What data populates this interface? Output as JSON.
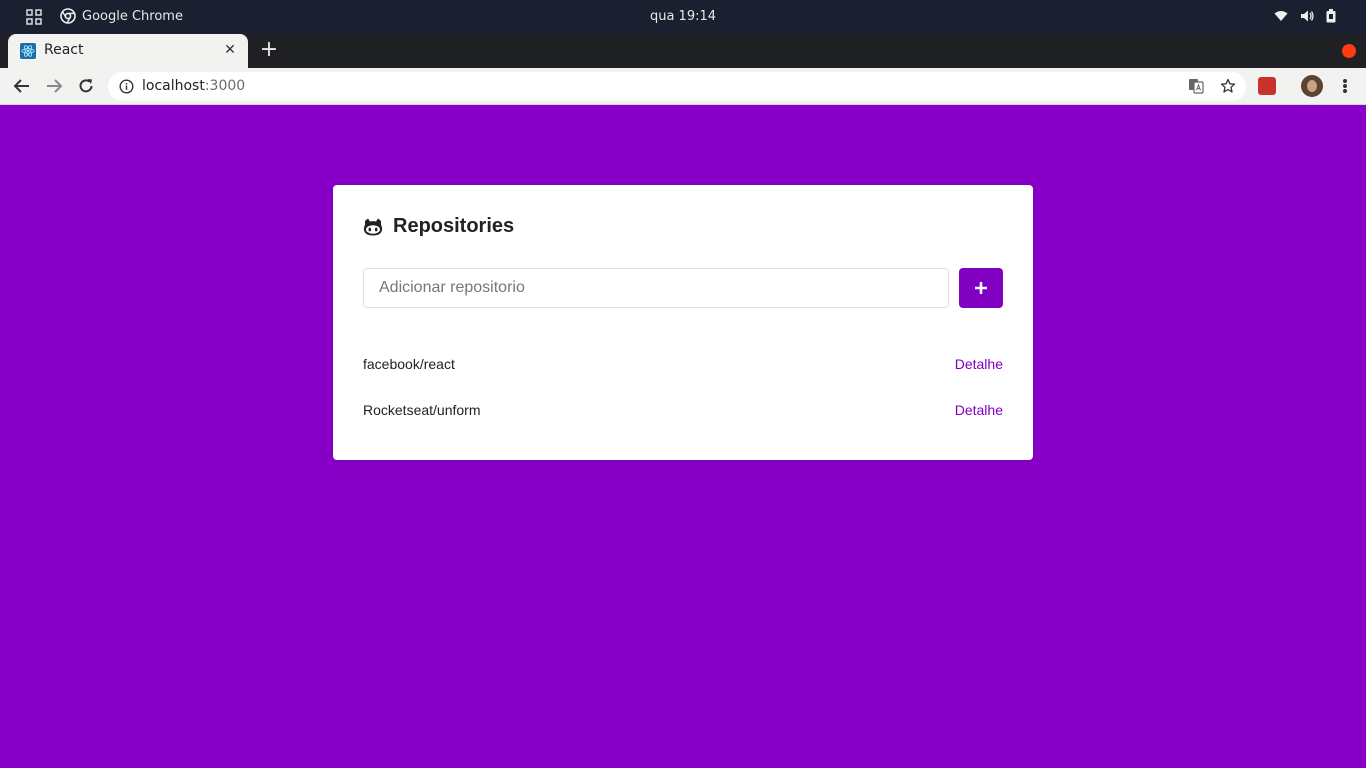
{
  "system_bar": {
    "app_name": "Google Chrome",
    "clock": "qua 19:14"
  },
  "browser": {
    "tab": {
      "title": "React",
      "close": "✕"
    },
    "new_tab": "+",
    "url_host": "localhost",
    "url_port": ":3000"
  },
  "page": {
    "title": "Repositories",
    "input_placeholder": "Adicionar repositorio",
    "add_button": "+",
    "repositories": [
      {
        "name": "facebook/react",
        "link": "Detalhe"
      },
      {
        "name": "Rocketseat/unform",
        "link": "Detalhe"
      }
    ]
  },
  "colors": {
    "background": "#8800c8",
    "accent": "#8000c2"
  }
}
